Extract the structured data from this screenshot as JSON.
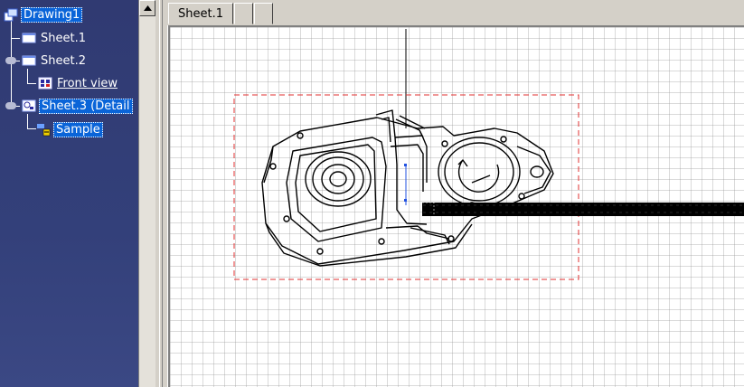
{
  "tree": {
    "root_label": "Drawing1",
    "nodes": [
      {
        "label": "Sheet.1"
      },
      {
        "label": "Sheet.2"
      },
      {
        "label": "Front view"
      },
      {
        "label": "Sheet.3 (Detail"
      },
      {
        "label": "Sample"
      }
    ]
  },
  "tabs": [
    {
      "label": "Sheet.1"
    },
    {
      "label": ""
    },
    {
      "label": ""
    }
  ],
  "colors": {
    "tree_bg": "#303a72",
    "selection": "#0a64d8",
    "frame_dash": "#e03030",
    "canvas_bg": "#ffffff"
  },
  "icons": [
    "tree-drawing-icon",
    "sheet-icon",
    "view-icon",
    "detail-sheet-icon",
    "sketch-icon",
    "scroll-up-arrow-icon"
  ]
}
